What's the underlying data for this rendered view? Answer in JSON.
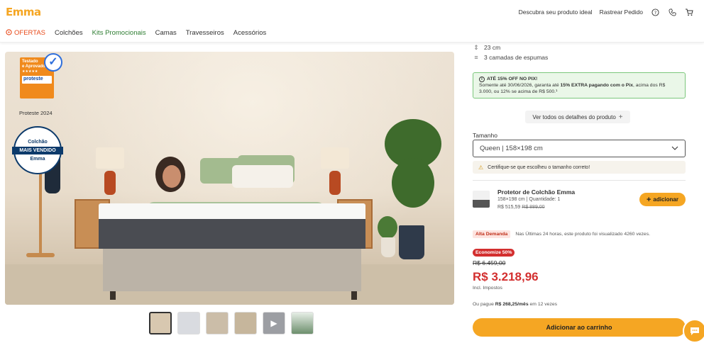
{
  "brand": {
    "logo": "Emma"
  },
  "topbar": {
    "discover": "Descubra seu produto ideal",
    "track": "Rastrear Pedido",
    "icons": [
      "help-icon",
      "phone-icon",
      "cart-icon"
    ]
  },
  "nav": {
    "items": [
      "OFERTAS",
      "Colchões",
      "Kits Promocionais",
      "Camas",
      "Travesseiros",
      "Acessórios"
    ]
  },
  "hero": {
    "test_badge": {
      "line1": "Testado",
      "line2": "e Aprovado",
      "stars": "★★★★★",
      "brand": "proteste"
    },
    "test_caption": "Proteste 2024",
    "seal": {
      "top": "Colchão",
      "middle": "MAIS VENDIDO",
      "bottom": "Emma"
    }
  },
  "specs": [
    {
      "icon": "height-icon",
      "text": "23 cm"
    },
    {
      "icon": "layers-icon",
      "text": "3 camadas de espumas"
    }
  ],
  "promo": {
    "title": "ATÉ 15% OFF NO PIX!",
    "body_pre": "Somente até 30/06/2026, garanta até ",
    "body_bold": "15% EXTRA pagando com o Pix",
    "body_post": ", acima dos R$ 3.000, ou 12% se acima de R$ 500.¹"
  },
  "details_button": "Ver todos os detalhes do produto",
  "size": {
    "label": "Tamanho",
    "value": "Queen | 158×198 cm",
    "warning": "Certifique-se que escolheu o tamanho correto!"
  },
  "protector": {
    "name": "Protetor de Colchão Emma",
    "detail": "158×198 cm | Quantidade: 1",
    "price": "R$ 515,59",
    "old_price": "R$ 889,00",
    "add_label": "adicionar"
  },
  "demand": {
    "badge": "Alta Demanda",
    "text": "Nas Últimas 24 horas, este produto foi visualizado 4260 vezes."
  },
  "pricing": {
    "discount_badge": "Economize 50%",
    "old_price": "R$ 6.459,00",
    "price": "R$ 3.218,96",
    "tax_note": "Incl. Impostos",
    "install_pre": "Ou pague ",
    "install_bold": "R$ 268,25/mês",
    "install_post": " em 12 vezes"
  },
  "cart_button": "Adicionar ao carrinho",
  "colors": {
    "accent": "#f5a623",
    "price_red": "#d32f2f",
    "promo_green": "#7bc77b"
  }
}
